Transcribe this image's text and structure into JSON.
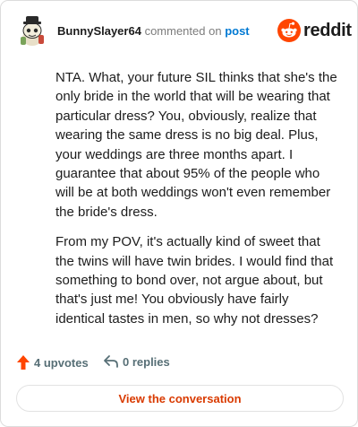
{
  "comment": {
    "username": "BunnySlayer64",
    "action_text": "commented on",
    "post_link": "post",
    "avatar_icon": "snoo-avatar-icon",
    "paragraphs": [
      "NTA. What, your future SIL thinks that she's the only bride in the world that will be wearing that particular dress? You, obviously, realize that wearing the same dress is no big deal. Plus, your weddings are three months apart. I guarantee that about 95% of the people who will be at both weddings won't even remember the bride's dress.",
      "From my POV, it's actually kind of sweet that the twins will have twin brides. I would find that something to bond over, not argue about, but that's just me! You obviously have fairly identical tastes in men, so why not dresses?"
    ]
  },
  "brand": {
    "logo_text": "reddit",
    "logo_icon": "reddit-logo-icon",
    "accent_color": "#ff4500",
    "link_color": "#0079d3",
    "cta_color": "#d93a00"
  },
  "actions": {
    "upvotes": "4 upvotes",
    "upvote_icon": "upvote-arrow-icon",
    "replies": "0 replies",
    "reply_icon": "reply-arrow-icon"
  },
  "cta": {
    "label": "View the conversation"
  }
}
